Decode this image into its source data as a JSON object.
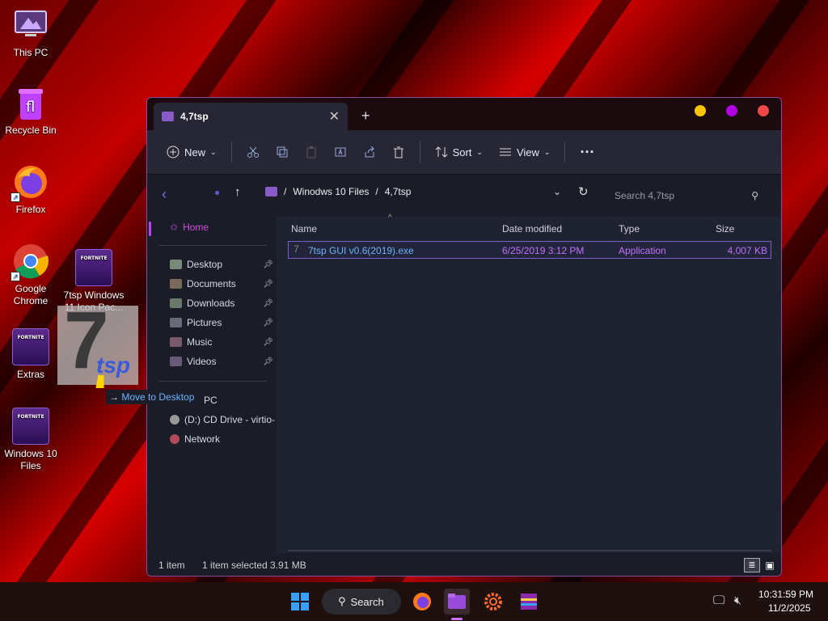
{
  "desktop": {
    "icons": [
      {
        "label": "This PC"
      },
      {
        "label": "Recycle Bin"
      },
      {
        "label": "Firefox"
      },
      {
        "label": "Google Chrome"
      },
      {
        "label": "7tsp Windows 11 Icon Pac..."
      },
      {
        "label": "Extras"
      },
      {
        "label": "Windows 10 Files"
      }
    ]
  },
  "drag": {
    "tooltip": "Move to Desktop",
    "overlay_text": "PC"
  },
  "window": {
    "tab_title": "4,7tsp",
    "toolbar": {
      "new_label": "New",
      "sort_label": "Sort",
      "view_label": "View"
    },
    "address": {
      "crumbs": [
        "Winodws 10 Files",
        "4,7tsp"
      ],
      "search_placeholder": "Search 4,7tsp"
    },
    "sidebar": {
      "home": "Home",
      "items": [
        "Desktop",
        "Documents",
        "Downloads",
        "Pictures",
        "Music",
        "Videos"
      ],
      "drives": [
        "PC",
        "(D:) CD Drive - virtio-",
        "Network"
      ]
    },
    "columns": {
      "name": "Name",
      "date": "Date modified",
      "type": "Type",
      "size": "Size"
    },
    "files": [
      {
        "name": "7tsp GUI v0.6(2019).exe",
        "date": "6/25/2019 3:12 PM",
        "type": "Application",
        "size": "4,007 KB"
      }
    ],
    "status": {
      "count": "1 item",
      "selected": "1 item selected 3.91 MB"
    }
  },
  "taskbar": {
    "search_label": "Search",
    "time": "10:31:59 PM",
    "date": "11/2/2025"
  },
  "colors": {
    "accent": "#c070ff",
    "home": "#d050e0"
  }
}
